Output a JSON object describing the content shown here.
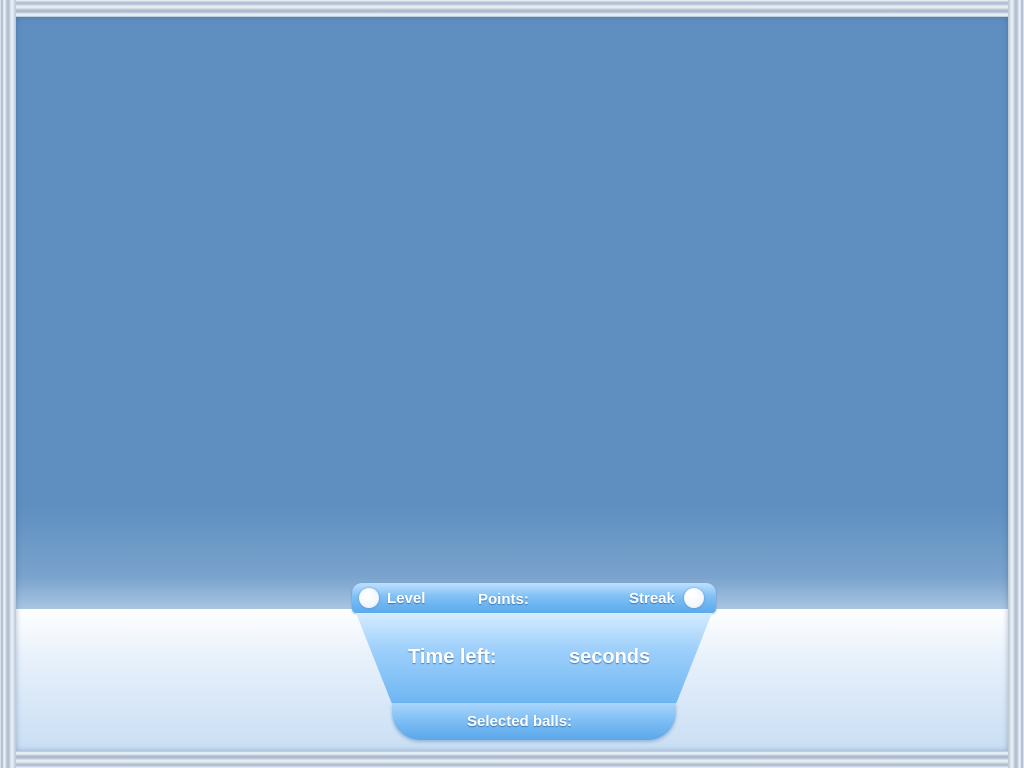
{
  "hud": {
    "level_label": "Level",
    "points_label": "Points:",
    "streak_label": "Streak",
    "time_left_label": "Time left:",
    "seconds_label": "seconds",
    "selected_balls_label": "Selected balls:"
  },
  "colors": {
    "playfield_blue": "#5e8fc0",
    "hud_blue": "#7fc0f5",
    "floor_white": "#ffffff"
  },
  "icons": {
    "level_indicator": "white-orb-icon",
    "streak_indicator": "white-orb-icon"
  }
}
